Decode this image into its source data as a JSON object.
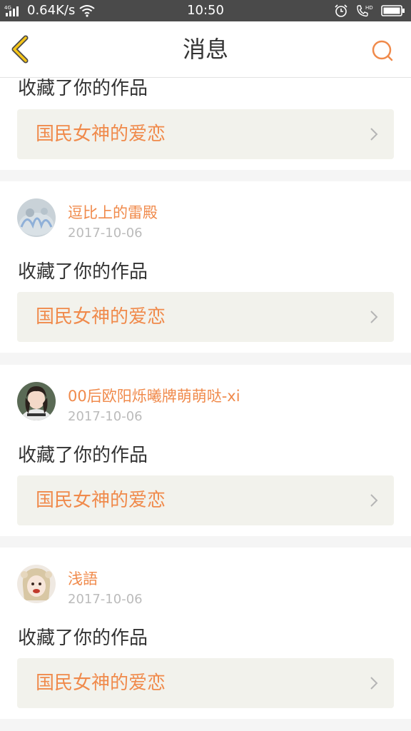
{
  "status_bar": {
    "network_label": "4G",
    "speed": "0.64K/s",
    "time": "10:50",
    "hd_label": "HD"
  },
  "header": {
    "title": "消息",
    "back_icon": "chevron-left-icon",
    "search_icon": "search-icon",
    "accent_color": "#f08a4b"
  },
  "messages": [
    {
      "action": "收藏了你的作品",
      "work_title": "国民女神的爱恋"
    },
    {
      "username": "逗比上的雷殿",
      "date": "2017-10-06",
      "action": "收藏了你的作品",
      "work_title": "国民女神的爱恋"
    },
    {
      "username": "00后欧阳烁曦牌萌萌哒-xi",
      "date": "2017-10-06",
      "action": "收藏了你的作品",
      "work_title": "国民女神的爱恋"
    },
    {
      "username": "浅語",
      "date": "2017-10-06",
      "action": "收藏了你的作品",
      "work_title": "国民女神的爱恋"
    }
  ]
}
